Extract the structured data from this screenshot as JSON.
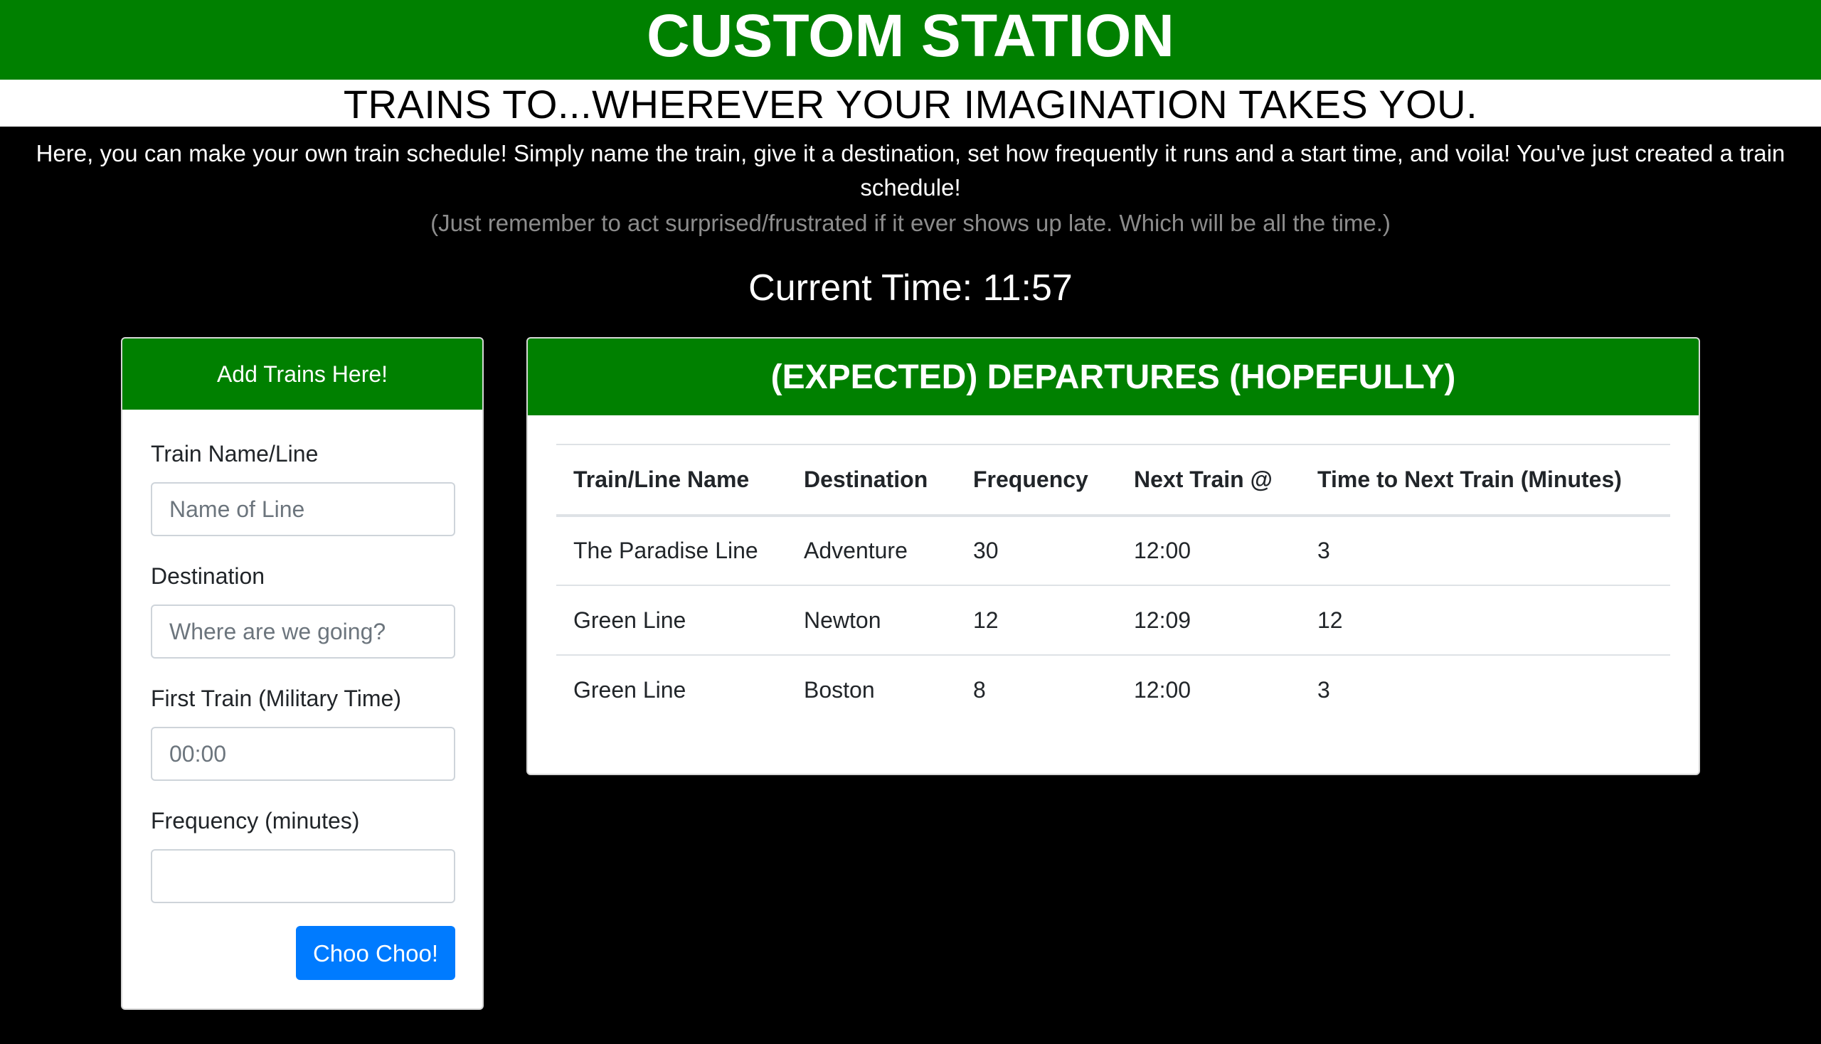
{
  "header": {
    "title": "CUSTOM STATION",
    "subtitle": "TRAINS TO...WHEREVER YOUR IMAGINATION TAKES YOU.",
    "intro": "Here, you can make your own train schedule! Simply name the train, give it a destination, set how frequently it runs and a start time, and voila! You've just created a train schedule!",
    "aside": "(Just remember to act surprised/frustrated if it ever shows up late. Which will be all the time.)",
    "current_time": "Current Time: 11:57"
  },
  "form": {
    "title": "Add Trains Here!",
    "fields": [
      {
        "label": "Train Name/Line",
        "placeholder": "Name of Line",
        "value": ""
      },
      {
        "label": "Destination",
        "placeholder": "Where are we going?",
        "value": ""
      },
      {
        "label": "First Train (Military Time)",
        "placeholder": "00:00",
        "value": ""
      },
      {
        "label": "Frequency (minutes)",
        "placeholder": "",
        "value": ""
      }
    ],
    "submit_label": "Choo Choo!"
  },
  "departures": {
    "title": "(EXPECTED) DEPARTURES (HOPEFULLY)",
    "columns": [
      "Train/Line Name",
      "Destination",
      "Frequency",
      "Next Train @",
      "Time to Next Train (Minutes)"
    ],
    "rows": [
      [
        "The Paradise Line",
        "Adventure",
        "30",
        "12:00",
        "3"
      ],
      [
        "Green Line",
        "Newton",
        "12",
        "12:09",
        "12"
      ],
      [
        "Green Line",
        "Boston",
        "8",
        "12:00",
        "3"
      ]
    ]
  },
  "colors": {
    "brand_green": "#008000",
    "button_blue": "#007bff",
    "background": "#000000"
  }
}
